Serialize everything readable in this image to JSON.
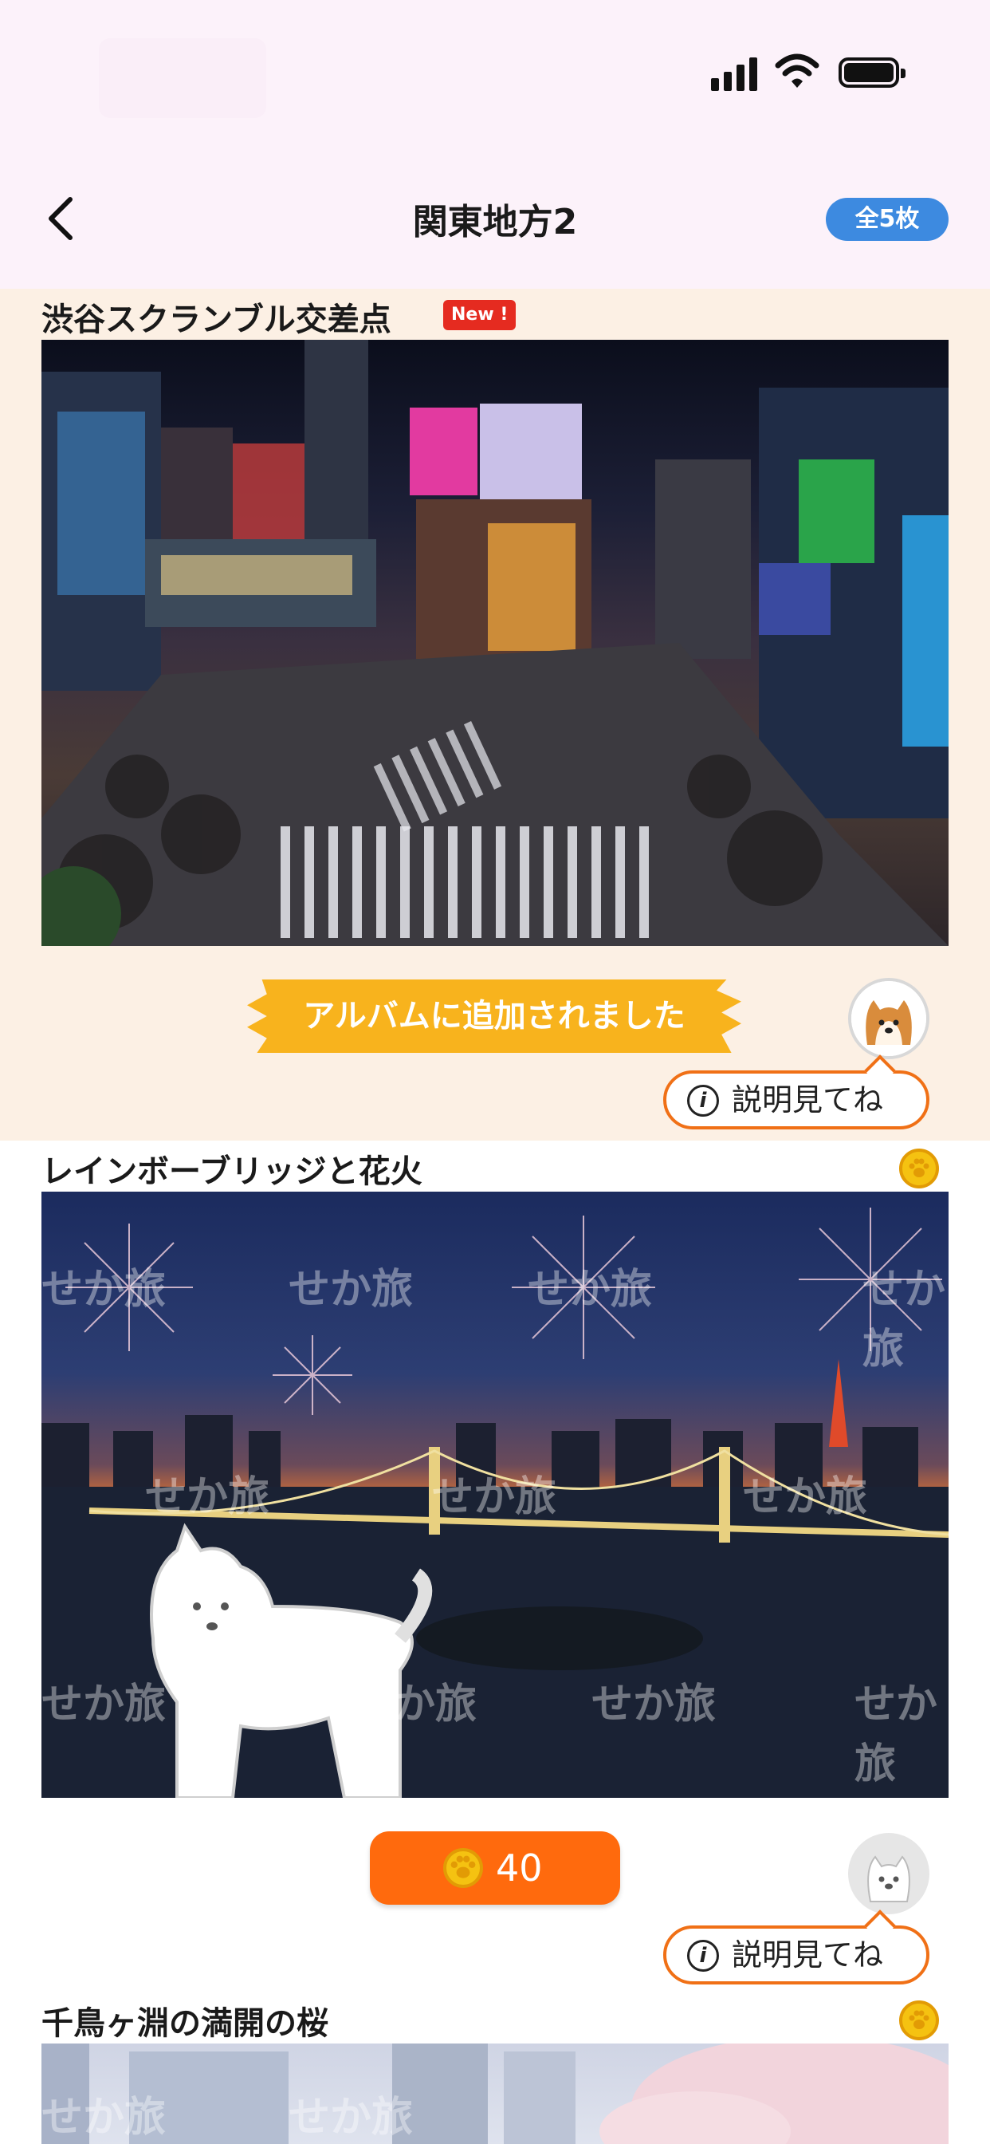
{
  "header": {
    "back_icon": "chevron-left-icon",
    "title": "関東地方2",
    "count_badge": "全5枚"
  },
  "status_bar": {
    "icons": [
      "signal-icon",
      "wifi-icon",
      "battery-icon"
    ]
  },
  "items": [
    {
      "title": "渋谷スクランブル交差点",
      "new_badge": "New !",
      "added_banner": "アルバムに追加されました",
      "explain_label": "説明見てね"
    },
    {
      "title": "レインボーブリッジと花火",
      "watermark": "せか旅",
      "price": "40",
      "explain_label": "説明見てね"
    },
    {
      "title": "千鳥ヶ淵の満開の桜",
      "watermark": "せか旅"
    }
  ],
  "colors": {
    "accent_orange": "#ff6a0d",
    "badge_blue": "#3d8ae0",
    "banner_yellow": "#f8b31d",
    "new_red": "#e52b20",
    "coin_gold": "#f5c211"
  }
}
